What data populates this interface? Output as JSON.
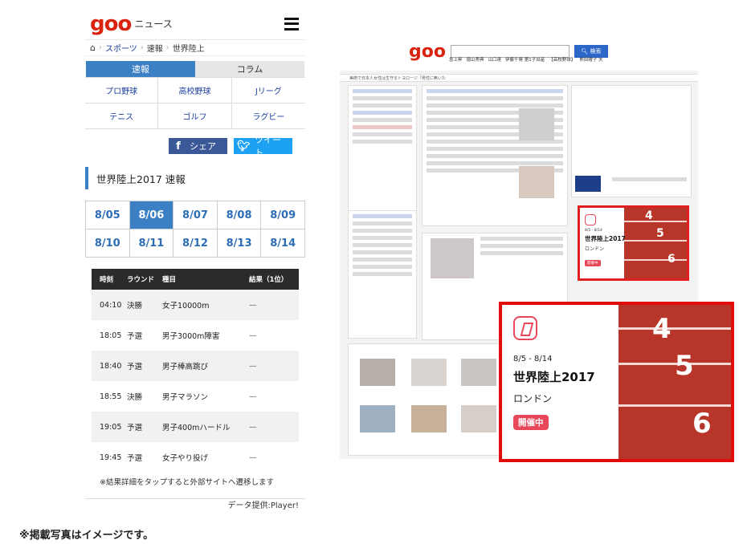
{
  "mobile": {
    "logo": "goo",
    "logo_sub": "ニュース",
    "breadcrumb": [
      "スポーツ",
      "速報",
      "世界陸上"
    ],
    "tabs": [
      "速報",
      "コラム"
    ],
    "categories": [
      "プロ野球",
      "高校野球",
      "Jリーグ",
      "テニス",
      "ゴルフ",
      "ラグビー"
    ],
    "share": {
      "facebook": "シェア",
      "twitter": "ツイート"
    },
    "section_title": "世界陸上2017 速報",
    "dates": [
      "8/05",
      "8/06",
      "8/07",
      "8/08",
      "8/09",
      "8/10",
      "8/11",
      "8/12",
      "8/13",
      "8/14"
    ],
    "selected_date": "8/06",
    "schedule_headers": [
      "時刻",
      "ラウンド",
      "種目",
      "結果（1位）"
    ],
    "schedule": [
      {
        "time": "04:10",
        "round": "決勝",
        "event": "女子10000m",
        "result": "—"
      },
      {
        "time": "18:05",
        "round": "予選",
        "event": "男子3000m障害",
        "result": "—"
      },
      {
        "time": "18:40",
        "round": "予選",
        "event": "男子棒高跳び",
        "result": "—"
      },
      {
        "time": "18:55",
        "round": "決勝",
        "event": "男子マラソン",
        "result": "—"
      },
      {
        "time": "19:05",
        "round": "予選",
        "event": "男子400mハードル",
        "result": "—"
      },
      {
        "time": "19:45",
        "round": "予選",
        "event": "女子やり投げ",
        "result": "—"
      }
    ],
    "note": "※結果詳細をタップすると外部サイトへ遷移します",
    "credit": "データ提供:Player!"
  },
  "desktop": {
    "logo": "goo",
    "search_button": "検索",
    "nav": [
      "急上昇",
      "徳山秀典",
      "山口達",
      "伊藤千晃 第1子出産",
      "【高校野球】",
      "熊田曜子 夫"
    ],
    "ticker": "美術で日本人女性は生守るトヨロージ「男性に無いた",
    "small_ad": {
      "date": "8/5 - 8/14",
      "title": "世界陸上2017",
      "city": "ロンドン",
      "badge": "開催中"
    }
  },
  "big_ad": {
    "date": "8/5 - 8/14",
    "title": "世界陸上2017",
    "city": "ロンドン",
    "badge": "開催中",
    "lane_numbers": [
      "4",
      "5",
      "6"
    ]
  },
  "footnote": "※掲載写真はイメージです。"
}
